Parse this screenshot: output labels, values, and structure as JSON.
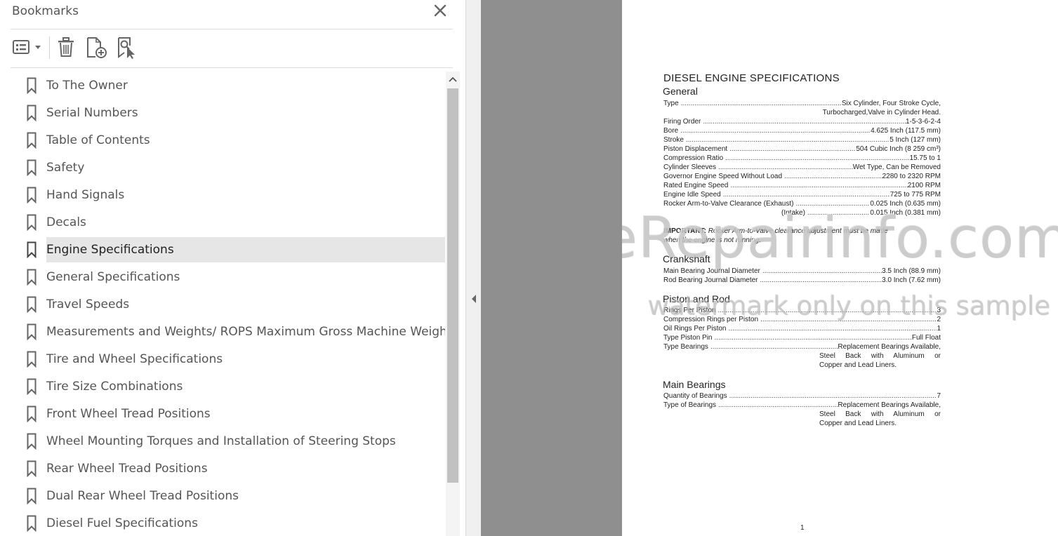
{
  "panel": {
    "title": "Bookmarks",
    "bookmarks": [
      {
        "label": "To The Owner"
      },
      {
        "label": "Serial Numbers"
      },
      {
        "label": "Table of Contents"
      },
      {
        "label": "Safety"
      },
      {
        "label": "Hand Signals"
      },
      {
        "label": "Decals"
      },
      {
        "label": "Engine Specifications",
        "selected": true
      },
      {
        "label": "General Specifications"
      },
      {
        "label": "Travel Speeds"
      },
      {
        "label": "Measurements and Weights/ ROPS Maximum Gross Machine Weight"
      },
      {
        "label": "Tire and Wheel Specifications"
      },
      {
        "label": "Tire Size Combinations"
      },
      {
        "label": "Front Wheel Tread Positions"
      },
      {
        "label": "Wheel Mounting Torques and Installation of Steering Stops"
      },
      {
        "label": "Rear Wheel Tread Positions"
      },
      {
        "label": "Dual Rear Wheel Tread Positions"
      },
      {
        "label": "Diesel Fuel Specifications"
      }
    ]
  },
  "document": {
    "title": "DIESEL ENGINE SPECIFICATIONS",
    "general": {
      "heading": "General",
      "type_key": "Type",
      "type_value": "Six Cylinder, Four Stroke Cycle,",
      "type_value_2": "Turbocharged,Valve in Cylinder Head.",
      "firing_key": "Firing Order",
      "firing_value": "1-5-3-6-2-4",
      "bore_key": "Bore",
      "bore_value": "4.625 Inch (117.5 mm)",
      "stroke_key": "Stroke",
      "stroke_value": "5 Inch (127 mm)",
      "disp_key": "Piston Displacement",
      "disp_value": "504 Cubic Inch (8 259 cm³)",
      "comp_key": "Compression Ratio",
      "comp_value": "15.75 to 1",
      "sleeve_key": "Cylinder Sleeves",
      "sleeve_value": "Wet Type, Can be Removed",
      "gov_key": "Governor Engine Speed Without Load",
      "gov_value": "2280 to 2320 RPM",
      "rated_key": "Rated Engine Speed",
      "rated_value": "2100 RPM",
      "idle_key": "Engine Idle Speed",
      "idle_value": "725 to 775 RPM",
      "rocker_key": "Rocker Arm-to-Valve Clearance (Exhaust)",
      "rocker_value": "0.025 Inch (0.635 mm)",
      "intake_key": "(Intake)",
      "intake_value": "0.015 Inch (0.381 mm)"
    },
    "important_label": "IMPORTANT:",
    "important_text": "Rocker Arm-to-Valve clearance adjustment must be made",
    "important_text_2": "when the engine is not running.",
    "crankshaft": {
      "heading": "Crankshaft",
      "main_key": "Main Bearing Journal Diameter",
      "main_value": "3.5 Inch (88.9 mm)",
      "rod_key": "Rod Bearing Journal Diameter",
      "rod_value": "3.0 Inch (7.62 mm)"
    },
    "piston": {
      "heading": "Piston and Rod",
      "rings_key": "Rings Per Piston",
      "rings_value": "3",
      "comp_key": "Compression Rings per Piston",
      "comp_value": "2",
      "oil_key": "Oil Rings Per Piston",
      "oil_value": "1",
      "pin_key": "Type Piston Pin",
      "pin_value": "Full Float",
      "bear_key": "Type Bearings",
      "bear_value": "Replacement Bearings Available,",
      "bear_value_2": "Steel Back with Aluminum or",
      "bear_value_3": "Copper and Lead Liners."
    },
    "main_bearings": {
      "heading": "Main Bearings",
      "qty_key": "Quantity of Bearings",
      "qty_value": "7",
      "type_key": "Type of Bearings",
      "type_value": "Replacement Bearings Available,",
      "type_value_2": "Steel Back with Aluminum or",
      "type_value_3": "Copper and Lead Liners."
    },
    "page_number": "1",
    "watermark_1": "eRepairinfo.com",
    "watermark_2": "watermark only on this sample"
  }
}
